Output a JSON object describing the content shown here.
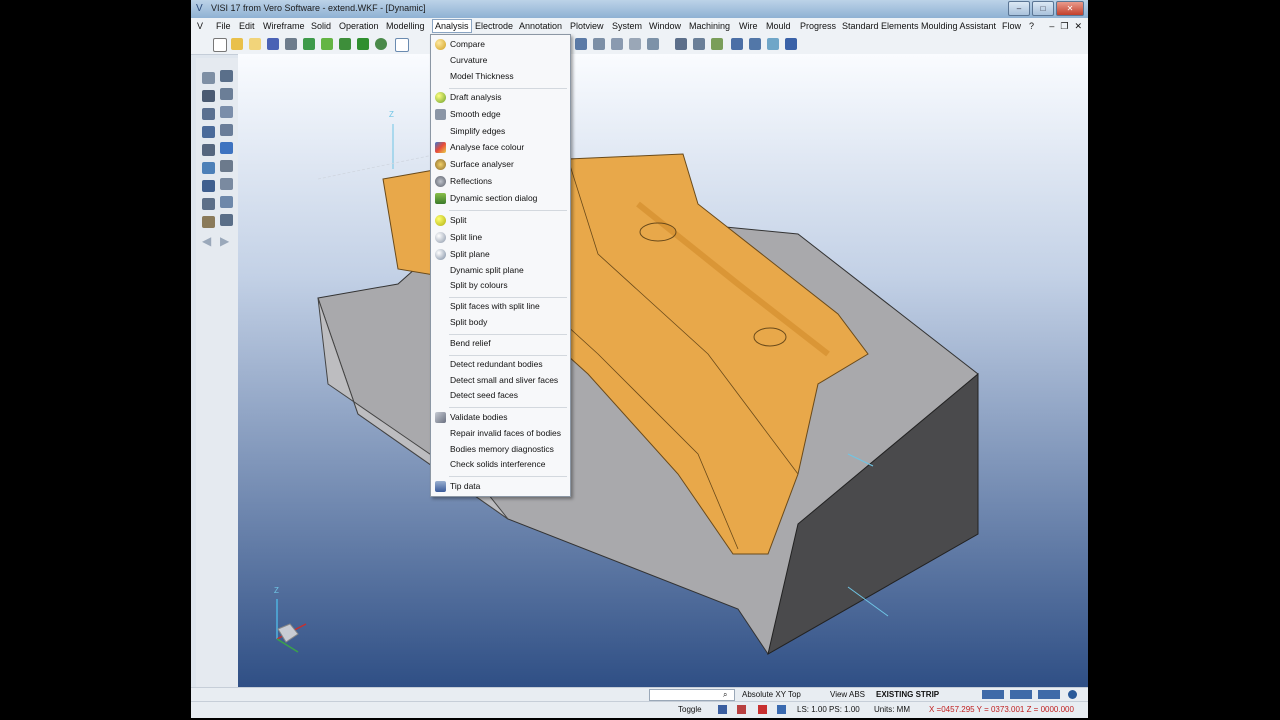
{
  "window": {
    "title": "VISI 17 from Vero Software - extend.WKF - [Dynamic]"
  },
  "menubar": {
    "items": [
      "File",
      "Edit",
      "Wireframe",
      "Solid",
      "Operation",
      "Modelling",
      "Analysis",
      "Electrode",
      "Annotation",
      "Plotview",
      "System",
      "Window",
      "Machining",
      "Wire",
      "Mould",
      "Progress",
      "Standard Elements",
      "Moulding Assistant",
      "Flow",
      "?"
    ],
    "active": "Analysis"
  },
  "analysis_menu": {
    "items": [
      {
        "label": "Compare",
        "icon": "compare-icon"
      },
      {
        "label": "Curvature"
      },
      {
        "label": "Model Thickness"
      },
      {
        "label": "Draft analysis",
        "icon": "draft-analysis-icon"
      },
      {
        "label": "Smooth edge",
        "icon": "smooth-edge-icon"
      },
      {
        "label": "Simplify edges"
      },
      {
        "label": "Analyse face colour",
        "icon": "face-colour-icon"
      },
      {
        "label": "Surface analyser",
        "icon": "surface-analyser-icon"
      },
      {
        "label": "Reflections",
        "icon": "reflections-icon"
      },
      {
        "label": "Dynamic section dialog",
        "icon": "section-dialog-icon"
      },
      {
        "label": "Split",
        "icon": "split-icon"
      },
      {
        "label": "Split line",
        "icon": "split-line-icon"
      },
      {
        "label": "Split plane",
        "icon": "split-plane-icon"
      },
      {
        "label": "Dynamic split plane"
      },
      {
        "label": "Split by colours"
      },
      {
        "label": "Split faces with split line"
      },
      {
        "label": "Split body"
      },
      {
        "label": "Bend relief"
      },
      {
        "label": "Detect redundant bodies"
      },
      {
        "label": "Detect small and sliver faces"
      },
      {
        "label": "Detect seed faces"
      },
      {
        "label": "Validate bodies",
        "icon": "validate-bodies-icon"
      },
      {
        "label": "Repair invalid faces of bodies"
      },
      {
        "label": "Bodies memory diagnostics"
      },
      {
        "label": "Check solids interference"
      },
      {
        "label": "Tip data",
        "icon": "tip-data-icon"
      }
    ]
  },
  "status": {
    "view_mode": "Absolute XY Top",
    "view_abs": "View ABS",
    "layer": "EXISTING STRIP",
    "toggle": "Toggle",
    "ls_ps": "LS: 1.00 PS: 1.00",
    "units": "Units: MM",
    "coords": "X =0457.295 Y = 0373.001 Z = 0000.000",
    "search_value": ""
  },
  "viewport": {
    "axis_labels": [
      "Z",
      "Z"
    ]
  },
  "colors": {
    "part_orange": "#e8a84a",
    "mould_grey": "#a9a9ac",
    "mould_dark": "#4a4a4c",
    "viewport_bg": "#2f4f85"
  }
}
